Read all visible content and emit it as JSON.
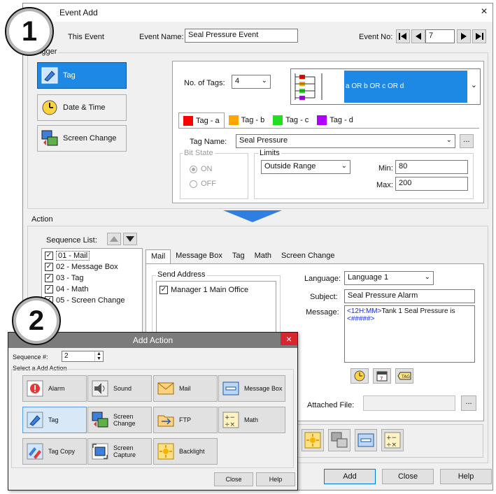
{
  "main_window": {
    "title": "Event Add",
    "close_glyph": "×",
    "this_event_label": "This Event",
    "event_name_label": "Event Name:",
    "event_name_value": "Seal Pressure Event",
    "event_no_label": "Event No:",
    "event_no_value": "7",
    "trigger_group_label": "Trigger",
    "categories": [
      {
        "label": "Tag",
        "icon": "tag-icon",
        "selected": true
      },
      {
        "label": "Date & Time",
        "icon": "clock-icon",
        "selected": false
      },
      {
        "label": "Screen Change",
        "icon": "screen-change-icon",
        "selected": false
      }
    ],
    "no_of_tags_label": "No. of Tags:",
    "no_of_tags_value": "4",
    "logic_preview_text": "a OR b OR c OR d",
    "tag_tabs": [
      {
        "label": "Tag - a",
        "color": "#ff0000"
      },
      {
        "label": "Tag - b",
        "color": "#ffa500"
      },
      {
        "label": "Tag - c",
        "color": "#22dd22"
      },
      {
        "label": "Tag - d",
        "color": "#b000ff"
      }
    ],
    "tag_name_label": "Tag Name:",
    "tag_name_value": "Seal Pressure",
    "browse_glyph": "...",
    "bit_state_label": "Bit State",
    "bit_on_label": "ON",
    "bit_off_label": "OFF",
    "limits_label": "Limits",
    "limits_value": "Outside Range",
    "min_label": "Min:",
    "min_value": "80",
    "max_label": "Max:",
    "max_value": "200",
    "action_group_label": "Action",
    "sequence_list_label": "Sequence List:",
    "sequence_items": [
      {
        "label": "01 - Mail",
        "checked": true,
        "selected": true
      },
      {
        "label": "02 - Message Box",
        "checked": true,
        "selected": false
      },
      {
        "label": "03 - Tag",
        "checked": true,
        "selected": false
      },
      {
        "label": "04 - Math",
        "checked": true,
        "selected": false
      },
      {
        "label": "05 - Screen Change",
        "checked": true,
        "selected": false
      }
    ],
    "action_tabs": [
      "Mail",
      "Message Box",
      "Tag",
      "Math",
      "Screen Change"
    ],
    "send_address_label": "Send Address",
    "send_address_items": [
      {
        "label": "Manager 1 Main Office",
        "checked": true
      }
    ],
    "language_label": "Language:",
    "language_value": "Language 1",
    "subject_label": "Subject:",
    "subject_value": "Seal Pressure Alarm",
    "message_label": "Message:",
    "message_tag1": "<12H:MM>",
    "message_text": "Tank 1 Seal Pressure is",
    "message_tag2": "<#####>",
    "attached_file_label": "Attached File:",
    "attached_browse_glyph": "...",
    "add_button": "Add",
    "close_button": "Close",
    "help_button": "Help"
  },
  "callouts": {
    "one": "1",
    "two": "2"
  },
  "add_action_dialog": {
    "title": "Add Action",
    "close_glyph": "×",
    "sequence_label": "Sequence #:",
    "sequence_value": "2",
    "select_label": "Select a Add Action",
    "actions": [
      {
        "label": "Alarm",
        "icon": "alarm-icon",
        "selected": false
      },
      {
        "label": "Sound",
        "icon": "sound-icon",
        "selected": false
      },
      {
        "label": "Mail",
        "icon": "mail-icon",
        "selected": false
      },
      {
        "label": "Message Box",
        "icon": "message-box-icon",
        "selected": false
      },
      {
        "label": "Tag",
        "icon": "tag-icon",
        "selected": true
      },
      {
        "label": "Screen Change",
        "icon": "screen-change-icon",
        "selected": false
      },
      {
        "label": "FTP",
        "icon": "ftp-icon",
        "selected": false
      },
      {
        "label": "Math",
        "icon": "math-icon",
        "selected": false
      },
      {
        "label": "Tag Copy",
        "icon": "tag-copy-icon",
        "selected": false
      },
      {
        "label": "Screen Capture",
        "icon": "screen-capture-icon",
        "selected": false
      },
      {
        "label": "Backlight",
        "icon": "backlight-icon",
        "selected": false
      }
    ],
    "close_button": "Close",
    "help_button": "Help"
  },
  "colors": {
    "selection_blue": "#1e88e5",
    "arrow_blue": "#2f7fe0",
    "dialog_titlebar": "#7b7b7b",
    "dialog_close": "#d7262e",
    "message_tag_blue": "#1a33cc"
  }
}
